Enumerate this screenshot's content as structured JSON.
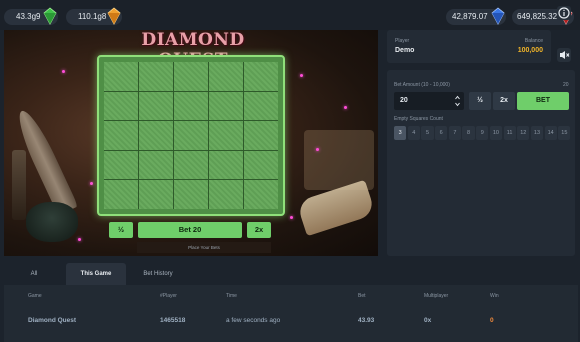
{
  "wallet": {
    "left": [
      {
        "amount": "43.3g9",
        "gem": "green"
      },
      {
        "amount": "110.1g8",
        "gem": "orange"
      }
    ],
    "right": [
      {
        "amount": "42,879.07",
        "gem": "blue"
      },
      {
        "amount": "649,825.32",
        "gem": "red"
      }
    ]
  },
  "icons": {
    "info": "info-icon",
    "sound": "mute-icon"
  },
  "colors": {
    "accent_green": "#6fce6a",
    "balance_gold": "#f0b429",
    "payout_orange": "#f08a3c"
  },
  "game": {
    "title": "DIAMOND QUEST",
    "grid_rows": 5,
    "grid_cols": 5,
    "buttons": {
      "half": "½",
      "bet": "Bet 20",
      "double": "2x"
    },
    "place_bets": "Place Your Bets"
  },
  "player_panel": {
    "player_label": "Player",
    "player_value": "Demo",
    "balance_label": "Balance",
    "balance_value": "100,000"
  },
  "bet_panel": {
    "amount_label": "Bet Amount (10 - 10,000)",
    "amount_right": "20",
    "amount_value": "20",
    "half_label": "½",
    "double_label": "2x",
    "bet_label": "BET",
    "empty_label": "Empty Squares Count",
    "counts": [
      "3",
      "4",
      "5",
      "6",
      "7",
      "8",
      "9",
      "10",
      "11",
      "12",
      "13",
      "14",
      "15"
    ],
    "selected_count": "3"
  },
  "tabs": [
    "All",
    "This Game",
    "Bet History"
  ],
  "active_tab": "This Game",
  "history": {
    "headers": [
      "Game",
      "#Player",
      "Time",
      "Bet",
      "Multiplayer",
      "Win"
    ],
    "rows": [
      [
        "Diamond Quest",
        "1465518",
        "a few seconds ago",
        "43.93",
        "0x",
        "0"
      ]
    ]
  }
}
